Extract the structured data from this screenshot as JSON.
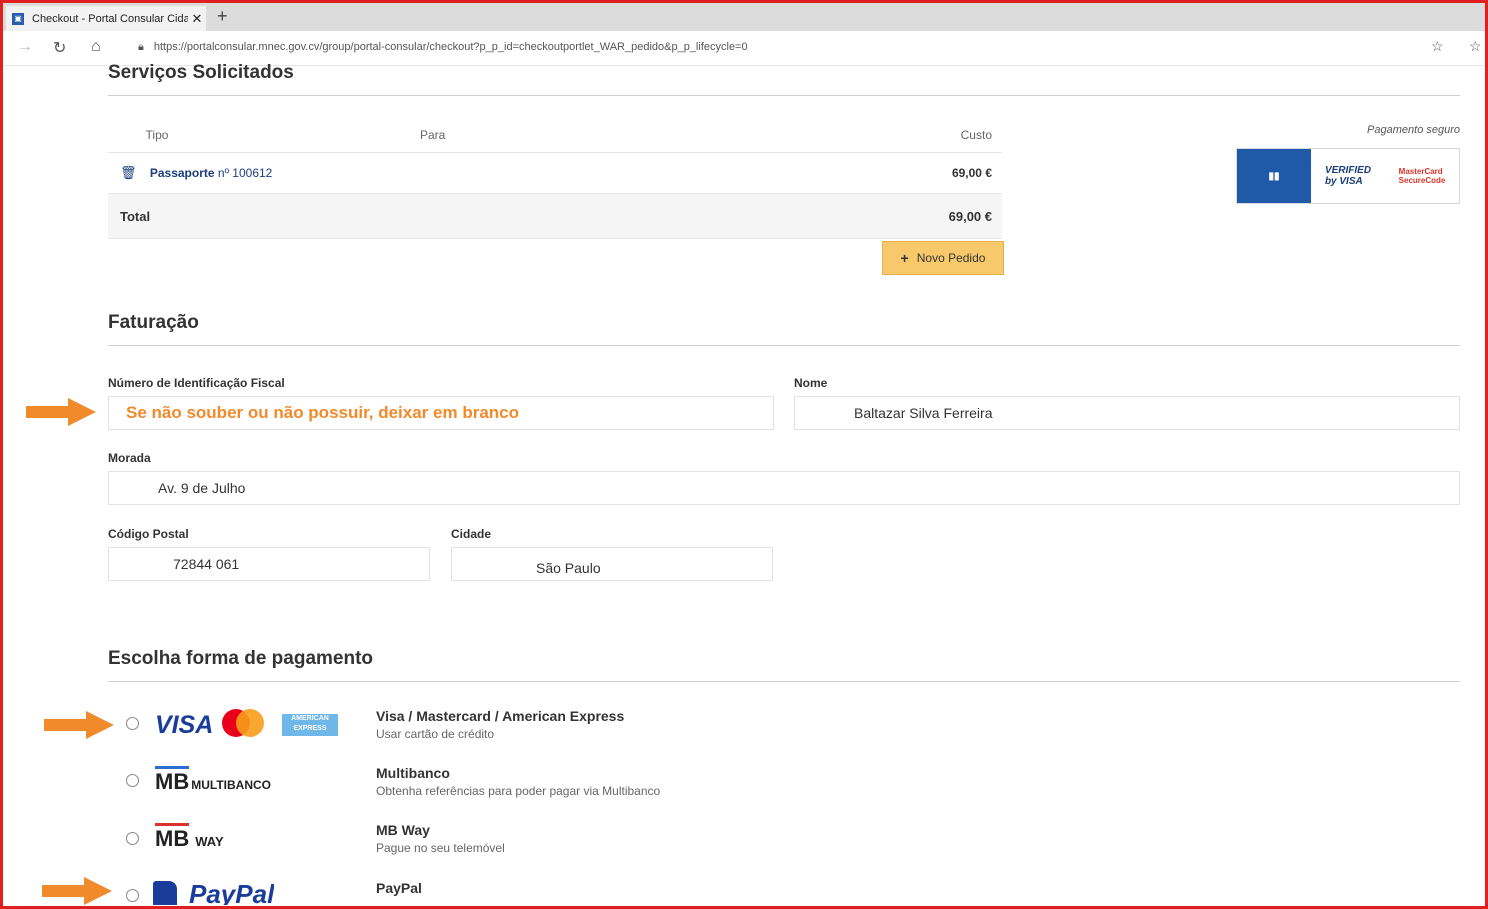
{
  "browser": {
    "tab_title": "Checkout - Portal Consular Cida",
    "url": "https://portalconsular.mnec.gov.cv/group/portal-consular/checkout?p_p_id=checkoutportlet_WAR_pedido&p_p_lifecycle=0"
  },
  "services": {
    "title": "Serviços Solicitados",
    "headers": [
      "Tipo",
      "Para",
      "Custo"
    ],
    "row": {
      "type": "Passaporte",
      "number": "nº 100612",
      "cost": "69,00 €"
    },
    "total_label": "Total",
    "total_value": "69,00 €",
    "new_order_button": "Novo Pedido",
    "secure_payment": "Pagamento seguro"
  },
  "billing": {
    "title": "Faturação",
    "nif_label": "Número de Identificação Fiscal",
    "nif_value": "Se não souber ou não possuir, deixar em branco",
    "name_label": "Nome",
    "name_value": "Baltazar Silva  Ferreira",
    "address_label": "Morada",
    "address_value": "Av. 9 de Julho",
    "postal_label": "Código Postal",
    "postal_value": "72844 061",
    "city_label": "Cidade",
    "city_value": "São Paulo"
  },
  "payment": {
    "title": "Escolha forma de pagamento",
    "options": [
      {
        "title": "Visa / Mastercard / American Express",
        "subtitle": "Usar cartão de crédito"
      },
      {
        "title": "Multibanco",
        "subtitle": "Obtenha referências para poder pagar via Multibanco"
      },
      {
        "title": "MB Way",
        "subtitle": "Pague no seu telemóvel"
      },
      {
        "title": "PayPal",
        "subtitle": ""
      }
    ],
    "logos": {
      "visa": "VISA",
      "amex": "AMERICAN EXPRESS",
      "mb": "MB",
      "multibanco": "MULTIBANCO",
      "way": "WAY",
      "paypal": "PayPal"
    }
  },
  "colors": {
    "accent_orange": "#f08a2a",
    "button_yellow": "#f8c96a",
    "frame_red": "#e02020",
    "link_blue": "#1a3d7c"
  }
}
